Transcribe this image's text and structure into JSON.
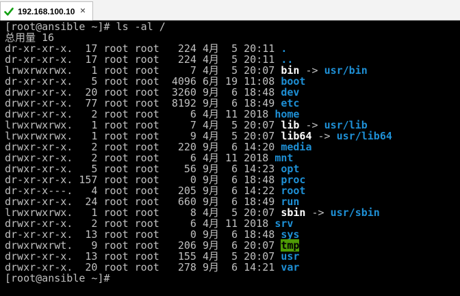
{
  "window": {
    "tab_title": "192.168.100.10",
    "tab_close": "×"
  },
  "terminal": {
    "command_line": "[root@ansible ~]# ls -al /",
    "total_line": "总用量 16",
    "prompt": "[root@ansible ~]#",
    "listing": [
      {
        "perm": "dr-xr-xr-x.",
        "links": "17",
        "owner": "root",
        "group": "root",
        "size": "224",
        "month": "4月",
        "day": "5",
        "time": "20:11",
        "name": ".",
        "kind": "dir"
      },
      {
        "perm": "dr-xr-xr-x.",
        "links": "17",
        "owner": "root",
        "group": "root",
        "size": "224",
        "month": "4月",
        "day": "5",
        "time": "20:11",
        "name": "..",
        "kind": "dir"
      },
      {
        "perm": "lrwxrwxrwx.",
        "links": "1",
        "owner": "root",
        "group": "root",
        "size": "7",
        "month": "4月",
        "day": "5",
        "time": "20:07",
        "name": "bin",
        "target": "usr/bin",
        "kind": "link"
      },
      {
        "perm": "dr-xr-xr-x.",
        "links": "5",
        "owner": "root",
        "group": "root",
        "size": "4096",
        "month": "6月",
        "day": "19",
        "time": "11:08",
        "name": "boot",
        "kind": "dir"
      },
      {
        "perm": "drwxr-xr-x.",
        "links": "20",
        "owner": "root",
        "group": "root",
        "size": "3260",
        "month": "9月",
        "day": "6",
        "time": "18:48",
        "name": "dev",
        "kind": "dir"
      },
      {
        "perm": "drwxr-xr-x.",
        "links": "77",
        "owner": "root",
        "group": "root",
        "size": "8192",
        "month": "9月",
        "day": "6",
        "time": "18:49",
        "name": "etc",
        "kind": "dir"
      },
      {
        "perm": "drwxr-xr-x.",
        "links": "2",
        "owner": "root",
        "group": "root",
        "size": "6",
        "month": "4月",
        "day": "11",
        "time": "2018",
        "name": "home",
        "kind": "dir"
      },
      {
        "perm": "lrwxrwxrwx.",
        "links": "1",
        "owner": "root",
        "group": "root",
        "size": "7",
        "month": "4月",
        "day": "5",
        "time": "20:07",
        "name": "lib",
        "target": "usr/lib",
        "kind": "link"
      },
      {
        "perm": "lrwxrwxrwx.",
        "links": "1",
        "owner": "root",
        "group": "root",
        "size": "9",
        "month": "4月",
        "day": "5",
        "time": "20:07",
        "name": "lib64",
        "target": "usr/lib64",
        "kind": "link"
      },
      {
        "perm": "drwxr-xr-x.",
        "links": "2",
        "owner": "root",
        "group": "root",
        "size": "220",
        "month": "9月",
        "day": "6",
        "time": "14:20",
        "name": "media",
        "kind": "dir"
      },
      {
        "perm": "drwxr-xr-x.",
        "links": "2",
        "owner": "root",
        "group": "root",
        "size": "6",
        "month": "4月",
        "day": "11",
        "time": "2018",
        "name": "mnt",
        "kind": "dir"
      },
      {
        "perm": "drwxr-xr-x.",
        "links": "5",
        "owner": "root",
        "group": "root",
        "size": "56",
        "month": "9月",
        "day": "6",
        "time": "14:23",
        "name": "opt",
        "kind": "dir"
      },
      {
        "perm": "dr-xr-xr-x.",
        "links": "157",
        "owner": "root",
        "group": "root",
        "size": "0",
        "month": "9月",
        "day": "6",
        "time": "18:48",
        "name": "proc",
        "kind": "dir"
      },
      {
        "perm": "dr-xr-x---.",
        "links": "4",
        "owner": "root",
        "group": "root",
        "size": "205",
        "month": "9月",
        "day": "6",
        "time": "14:22",
        "name": "root",
        "kind": "dir"
      },
      {
        "perm": "drwxr-xr-x.",
        "links": "24",
        "owner": "root",
        "group": "root",
        "size": "660",
        "month": "9月",
        "day": "6",
        "time": "18:49",
        "name": "run",
        "kind": "dir"
      },
      {
        "perm": "lrwxrwxrwx.",
        "links": "1",
        "owner": "root",
        "group": "root",
        "size": "8",
        "month": "4月",
        "day": "5",
        "time": "20:07",
        "name": "sbin",
        "target": "usr/sbin",
        "kind": "link"
      },
      {
        "perm": "drwxr-xr-x.",
        "links": "2",
        "owner": "root",
        "group": "root",
        "size": "6",
        "month": "4月",
        "day": "11",
        "time": "2018",
        "name": "srv",
        "kind": "dir"
      },
      {
        "perm": "dr-xr-xr-x.",
        "links": "13",
        "owner": "root",
        "group": "root",
        "size": "0",
        "month": "9月",
        "day": "6",
        "time": "18:48",
        "name": "sys",
        "kind": "dir"
      },
      {
        "perm": "drwxrwxrwt.",
        "links": "9",
        "owner": "root",
        "group": "root",
        "size": "206",
        "month": "9月",
        "day": "6",
        "time": "20:07",
        "name": "tmp",
        "kind": "sticky"
      },
      {
        "perm": "drwxr-xr-x.",
        "links": "13",
        "owner": "root",
        "group": "root",
        "size": "155",
        "month": "4月",
        "day": "5",
        "time": "20:07",
        "name": "usr",
        "kind": "dir"
      },
      {
        "perm": "drwxr-xr-x.",
        "links": "20",
        "owner": "root",
        "group": "root",
        "size": "278",
        "month": "9月",
        "day": "6",
        "time": "14:21",
        "name": "var",
        "kind": "dir"
      }
    ]
  },
  "colors": {
    "terminal_bg": "#000000",
    "text": "#c0c0c0",
    "directory": "#1e90d6",
    "symlink": "#ffffff",
    "sticky_bg": "#4e9a06",
    "connected_check": "#12a012"
  },
  "icons": {
    "connected": "check-icon",
    "close": "close-icon"
  }
}
